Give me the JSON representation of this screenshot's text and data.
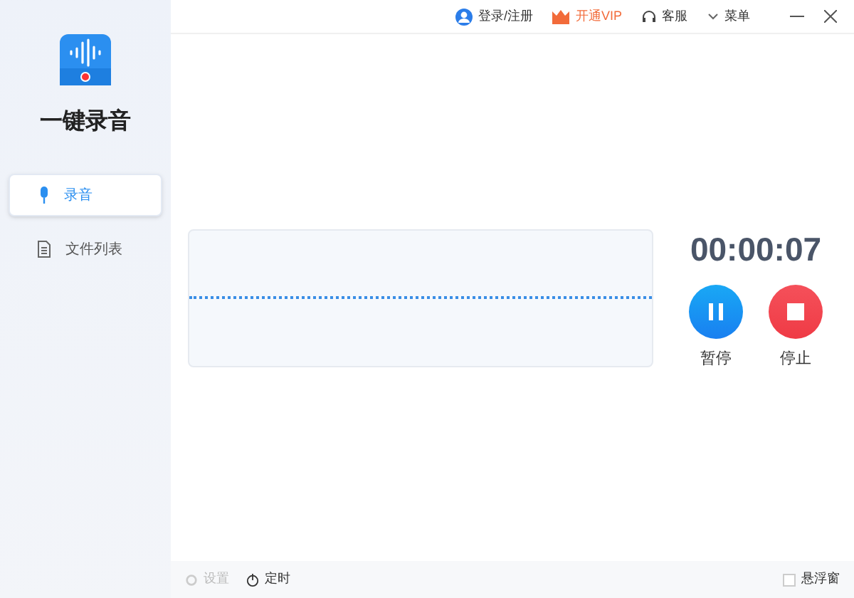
{
  "app": {
    "title": "一键录音"
  },
  "sidebar": {
    "items": [
      {
        "label": "录音",
        "kind": "mic",
        "selected": true
      },
      {
        "label": "文件列表",
        "kind": "file",
        "selected": false
      }
    ]
  },
  "topbar": {
    "items": [
      {
        "label": "登录/注册",
        "kind": "user"
      },
      {
        "label": "开通VIP",
        "kind": "vip"
      },
      {
        "label": "客服",
        "kind": "headset"
      },
      {
        "label": "菜单",
        "kind": "chevron"
      }
    ]
  },
  "recorder": {
    "timer": "00:00:07",
    "buttons": [
      {
        "label": "暂停",
        "kind": "pause"
      },
      {
        "label": "停止",
        "kind": "stop"
      }
    ]
  },
  "footer": {
    "items": [
      {
        "label": "设置",
        "kind": "gear",
        "disabled": true
      },
      {
        "label": "定时",
        "kind": "clock",
        "disabled": false
      }
    ],
    "float_window": {
      "label": "悬浮窗",
      "checked": false
    }
  }
}
